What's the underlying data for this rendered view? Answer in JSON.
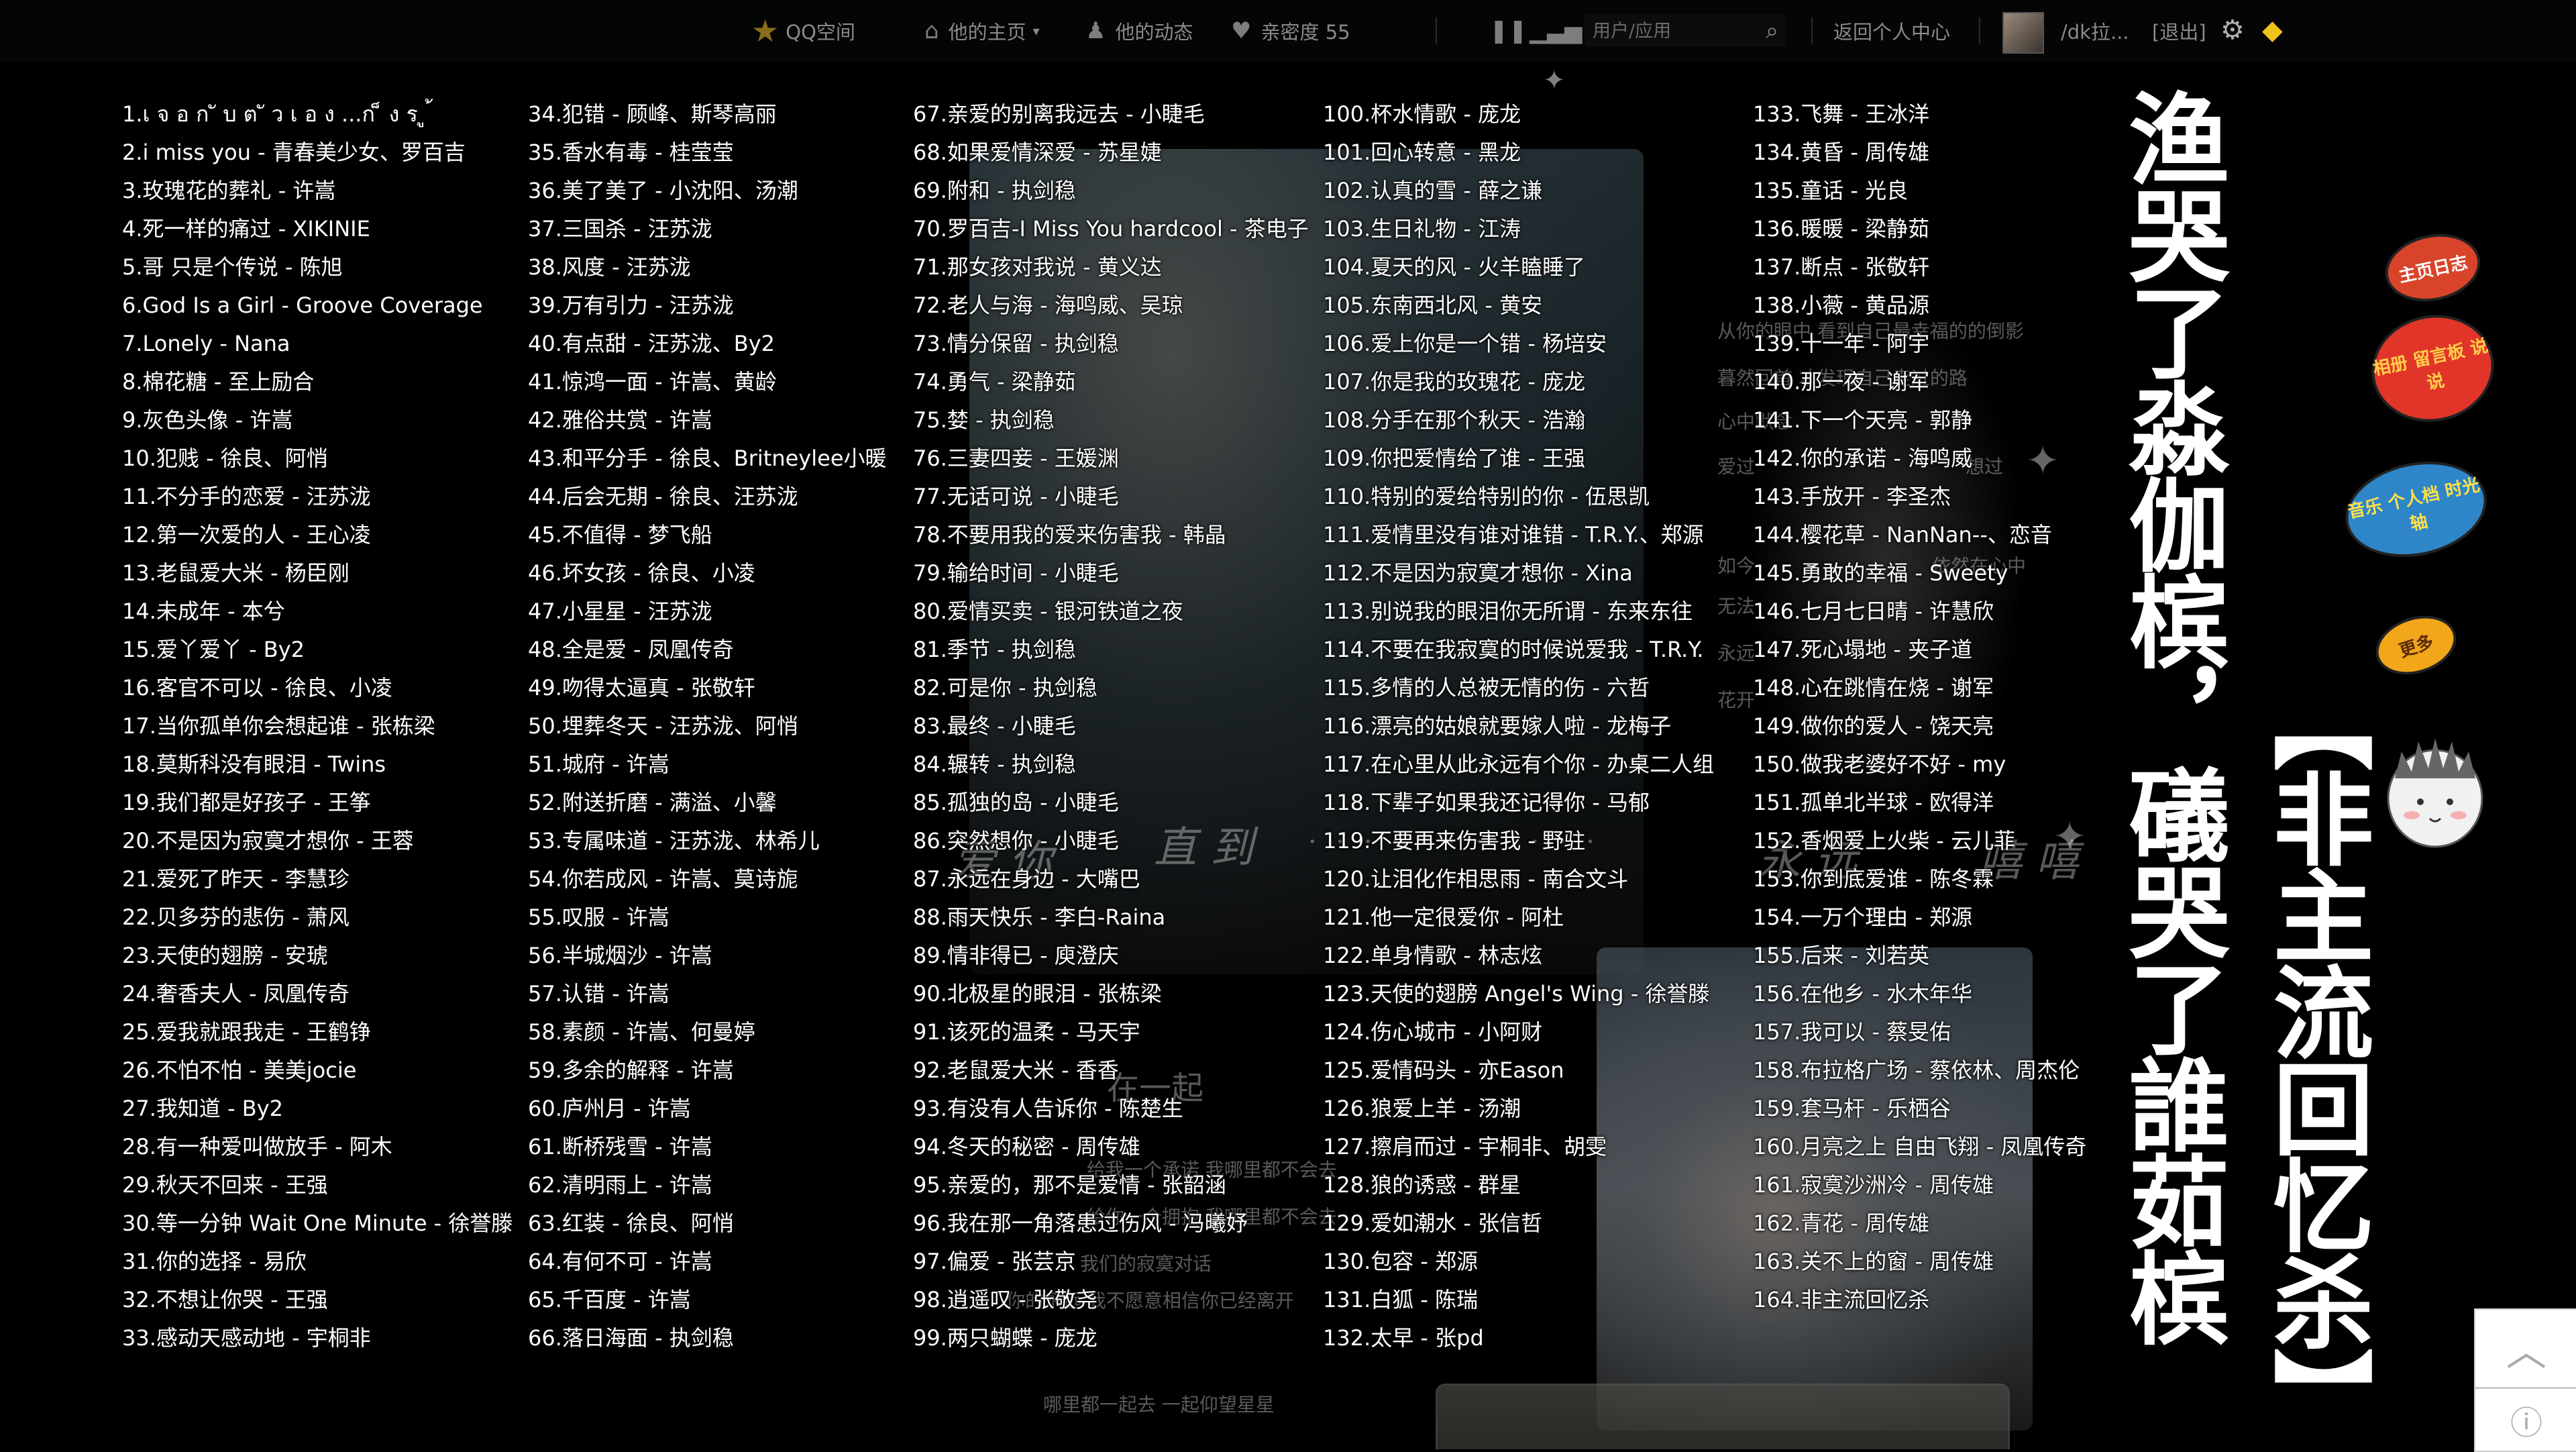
{
  "topbar": {
    "logo": "QQ空间",
    "home": "他的主页",
    "dynamics": "他的动态",
    "intimacy": "亲密度 55",
    "search_placeholder": "用户/应用",
    "back": "返回个人中心",
    "username": "/dk拉...",
    "logout": "[退出]",
    "icons": [
      "star-icon",
      "house-icon",
      "people-icon",
      "heart-icon",
      "pause-icon",
      "bars-icon",
      "search-icon",
      "gear-icon",
      "diamond-icon"
    ]
  },
  "songs": [
    [
      "1.เ จ อ ก ั บ ต ั ว เ อ ง ...ก ็ ง ร ู ้",
      "2.i miss you - 青春美少女、罗百吉",
      "3.玫瑰花的葬礼 - 许嵩",
      "4.死一样的痛过 - XIKINIE",
      "5.哥 只是个传说 - 陈旭",
      "6.God Is a Girl - Groove Coverage",
      "7.Lonely - Nana",
      "8.棉花糖 - 至上励合",
      "9.灰色头像 - 许嵩",
      "10.犯贱 - 徐良、阿悄",
      "11.不分手的恋爱 - 汪苏泷",
      "12.第一次爱的人 - 王心凌",
      "13.老鼠爱大米 - 杨臣刚",
      "14.未成年 - 本兮",
      "15.爱丫爱丫 - By2",
      "16.客官不可以 - 徐良、小凌",
      "17.当你孤单你会想起谁 - 张栋梁",
      "18.莫斯科没有眼泪 - Twins",
      "19.我们都是好孩子 - 王筝",
      "20.不是因为寂寞才想你 - 王蓉",
      "21.爱死了昨天 - 李慧珍",
      "22.贝多芬的悲伤 - 萧风",
      "23.天使的翅膀 - 安琥",
      "24.奢香夫人 - 凤凰传奇",
      "25.爱我就跟我走 - 王鹤铮",
      "26.不怕不怕 - 美美jocie",
      "27.我知道 - By2",
      "28.有一种爱叫做放手 - 阿木",
      "29.秋天不回来 - 王强",
      "30.等一分钟 Wait One Minute - 徐誉滕",
      "31.你的选择 - 易欣",
      "32.不想让你哭 - 王强",
      "33.感动天感动地 - 宇桐非"
    ],
    [
      "34.犯错 - 顾峰、斯琴高丽",
      "35.香水有毒 - 桂莹莹",
      "36.美了美了 - 小沈阳、汤潮",
      "37.三国杀 - 汪苏泷",
      "38.风度 - 汪苏泷",
      "39.万有引力 - 汪苏泷",
      "40.有点甜 - 汪苏泷、By2",
      "41.惊鸿一面 - 许嵩、黄龄",
      "42.雅俗共赏 - 许嵩",
      "43.和平分手 - 徐良、Britneylee小暖",
      "44.后会无期 - 徐良、汪苏泷",
      "45.不值得 - 梦飞船",
      "46.坏女孩 - 徐良、小凌",
      "47.小星星 - 汪苏泷",
      "48.全是爱 - 凤凰传奇",
      "49.吻得太逼真 - 张敬轩",
      "50.埋葬冬天 - 汪苏泷、阿悄",
      "51.城府 - 许嵩",
      "52.附送折磨 - 满溢、小馨",
      "53.专属味道 - 汪苏泷、林希儿",
      "54.你若成风 - 许嵩、莫诗旎",
      "55.叹服 - 许嵩",
      "56.半城烟沙 - 许嵩",
      "57.认错 - 许嵩",
      "58.素颜 - 许嵩、何曼婷",
      "59.多余的解释 - 许嵩",
      "60.庐州月 - 许嵩",
      "61.断桥残雪 - 许嵩",
      "62.清明雨上 - 许嵩",
      "63.红装 - 徐良、阿悄",
      "64.有何不可 - 许嵩",
      "65.千百度 - 许嵩",
      "66.落日海面 - 执剑稳"
    ],
    [
      "67.亲爱的别离我远去 - 小睫毛",
      "68.如果爱情深爱 - 苏星婕",
      "69.附和 - 执剑稳",
      "70.罗百吉-I Miss You hardcool - 茶电子",
      "71.那女孩对我说 - 黄义达",
      "72.老人与海 - 海鸣威、吴琼",
      "73.情分保留 - 执剑稳",
      "74.勇气 - 梁静茹",
      "75.婪 - 执剑稳",
      "76.三妻四妾 - 王媛渊",
      "77.无话可说 - 小睫毛",
      "78.不要用我的爱来伤害我 - 韩晶",
      "79.输给时间 - 小睫毛",
      "80.爱情买卖 - 银河铁道之夜",
      "81.季节 - 执剑稳",
      "82.可是你 - 执剑稳",
      "83.最终 - 小睫毛",
      "84.辗转 - 执剑稳",
      "85.孤独的岛 - 小睫毛",
      "86.突然想你 - 小睫毛",
      "87.永远在身边 - 大嘴巴",
      "88.雨天快乐 - 李白-Raina",
      "89.情非得已 - 庾澄庆",
      "90.北极星的眼泪 - 张栋梁",
      "91.该死的温柔 - 马天宇",
      "92.老鼠爱大米 - 香香",
      "93.有没有人告诉你 - 陈楚生",
      "94.冬天的秘密 - 周传雄",
      "95.亲爱的，那不是爱情 - 张韶涵",
      "96.我在那一角落患过伤风 - 冯曦妤",
      "97.偏爱 - 张芸京",
      "98.逍遥叹 - 张敬尧",
      "99.两只蝴蝶 - 庞龙"
    ],
    [
      "100.杯水情歌 - 庞龙",
      "101.回心转意 - 黑龙",
      "102.认真的雪 - 薛之谦",
      "103.生日礼物 - 江涛",
      "104.夏天的风 - 火羊瞌睡了",
      "105.东南西北风 - 黄安",
      "106.爱上你是一个错 - 杨培安",
      "107.你是我的玫瑰花 - 庞龙",
      "108.分手在那个秋天 - 浩瀚",
      "109.你把爱情给了谁 - 王强",
      "110.特别的爱给特别的你 - 伍思凯",
      "111.爱情里没有谁对谁错 - T.R.Y.、郑源",
      "112.不是因为寂寞才想你 - Xina",
      "113.别说我的眼泪你无所谓 - 东来东往",
      "114.不要在我寂寞的时候说爱我 - T.R.Y.",
      "115.多情的人总被无情的伤 - 六哲",
      "116.漂亮的姑娘就要嫁人啦 - 龙梅子",
      "117.在心里从此永远有个你 - 办桌二人组",
      "118.下辈子如果我还记得你 - 马郁",
      "119.不要再来伤害我 - 野驻",
      "120.让泪化作相思雨 - 南合文斗",
      "121.他一定很爱你 - 阿杜",
      "122.单身情歌 - 林志炫",
      "123.天使的翅膀 Angel's Wing - 徐誉滕",
      "124.伤心城市 - 小阿财",
      "125.爱情码头 - 亦Eason",
      "126.狼爱上羊 - 汤潮",
      "127.擦肩而过 - 宇桐非、胡雯",
      "128.狼的诱惑 - 群星",
      "129.爱如潮水 - 张信哲",
      "130.包容 - 郑源",
      "131.白狐 - 陈瑞",
      "132.太早 - 张pd"
    ],
    [
      "133.飞舞 - 王冰洋",
      "134.黄昏 - 周传雄",
      "135.童话 - 光良",
      "136.暖暖 - 梁静茹",
      "137.断点 - 张敬轩",
      "138.小薇 - 黄品源",
      "139.十一年 - 阿宇",
      "140.那一夜 - 谢军",
      "141.下一个天亮 - 郭静",
      "142.你的承诺 - 海鸣威",
      "143.手放开 - 李圣杰",
      "144.樱花草 - NanNan--、恋音",
      "145.勇敢的幸福 - Sweety",
      "146.七月七日晴 - 许慧欣",
      "147.死心塌地 - 夹子道",
      "148.心在跳情在烧 - 谢军",
      "149.做你的爱人 - 饶天亮",
      "150.做我老婆好不好 - my",
      "151.孤单北半球 - 欧得洋",
      "152.香烟爱上火柴 - 云儿菲",
      "153.你到底爱谁 - 陈冬霖",
      "154.一万个理由 - 郑源",
      "155.后来 - 刘若英",
      "156.在他乡 - 水木年华",
      "157.我可以 - 蔡旻佑",
      "158.布拉格广场 - 蔡依林、周杰伦",
      "159.套马杆 - 乐栖谷",
      "160.月亮之上 自由飞翔 - 凤凰传奇",
      "161.寂寞沙洲冷 - 周传雄",
      "162.青花 - 周传雄",
      "163.关不上的窗 - 周传雄",
      "164.非主流回忆杀"
    ]
  ],
  "titles": {
    "vertical_1": "渔哭了淼伽槟，礒哭了誰茹槟",
    "vertical_2": "【非主流回忆杀】"
  },
  "widgets": {
    "diary": "主页日志",
    "board": "相册 留言板 说说",
    "music": "音乐 个人档 时光轴",
    "more": "更多"
  },
  "bg_texts": {
    "b1": "爱 你",
    "b2": "直 到",
    "b3": "永 远",
    "b4": "嘻 嘻",
    "b5": "在一起",
    "b6": "给我一个承诺 我哪里都不会去",
    "b7": "给你一个拥抱 我哪里都不会去",
    "b8": "我们的寂寞对话",
    "b9": "你的永远 我不愿意相信你已经离开",
    "b10": "哪里都一起去 一起仰望星星",
    "b11": "从你的眼中 看到自己最幸福的的倒影",
    "b12": "暮然回首 才发现自己走过的路",
    "b13": "心中默念",
    "b14": "爱过",
    "b15": "如今",
    "b16": "无法",
    "b17": "永远",
    "b18": "花开",
    "b19": "想过",
    "b20": "依然在心中"
  }
}
